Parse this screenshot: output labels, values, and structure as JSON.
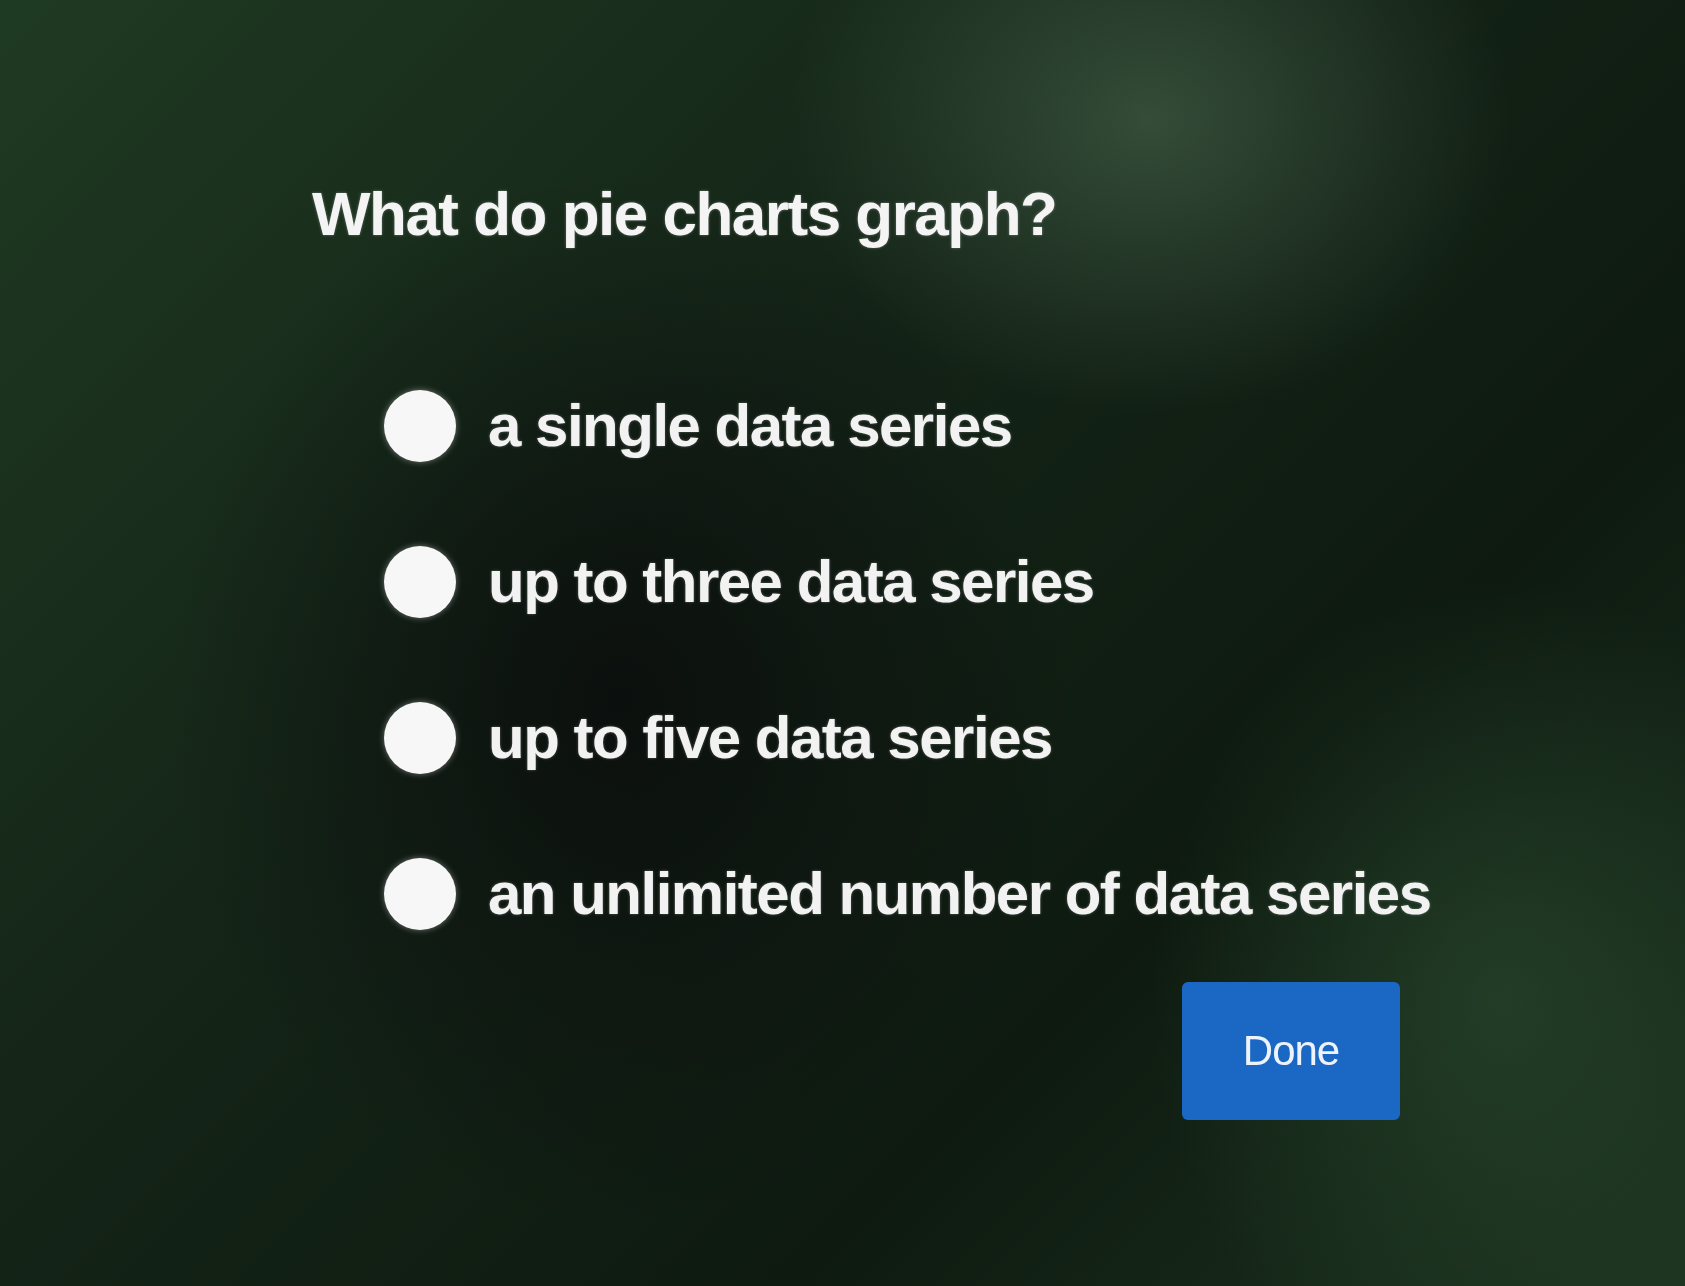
{
  "question": "What do pie charts graph?",
  "options": [
    {
      "label": "a single data series",
      "selected": false
    },
    {
      "label": "up to three data series",
      "selected": false
    },
    {
      "label": "up to five data series",
      "selected": false
    },
    {
      "label": "an unlimited number of data series",
      "selected": false
    }
  ],
  "done_button": {
    "label": "Done"
  }
}
